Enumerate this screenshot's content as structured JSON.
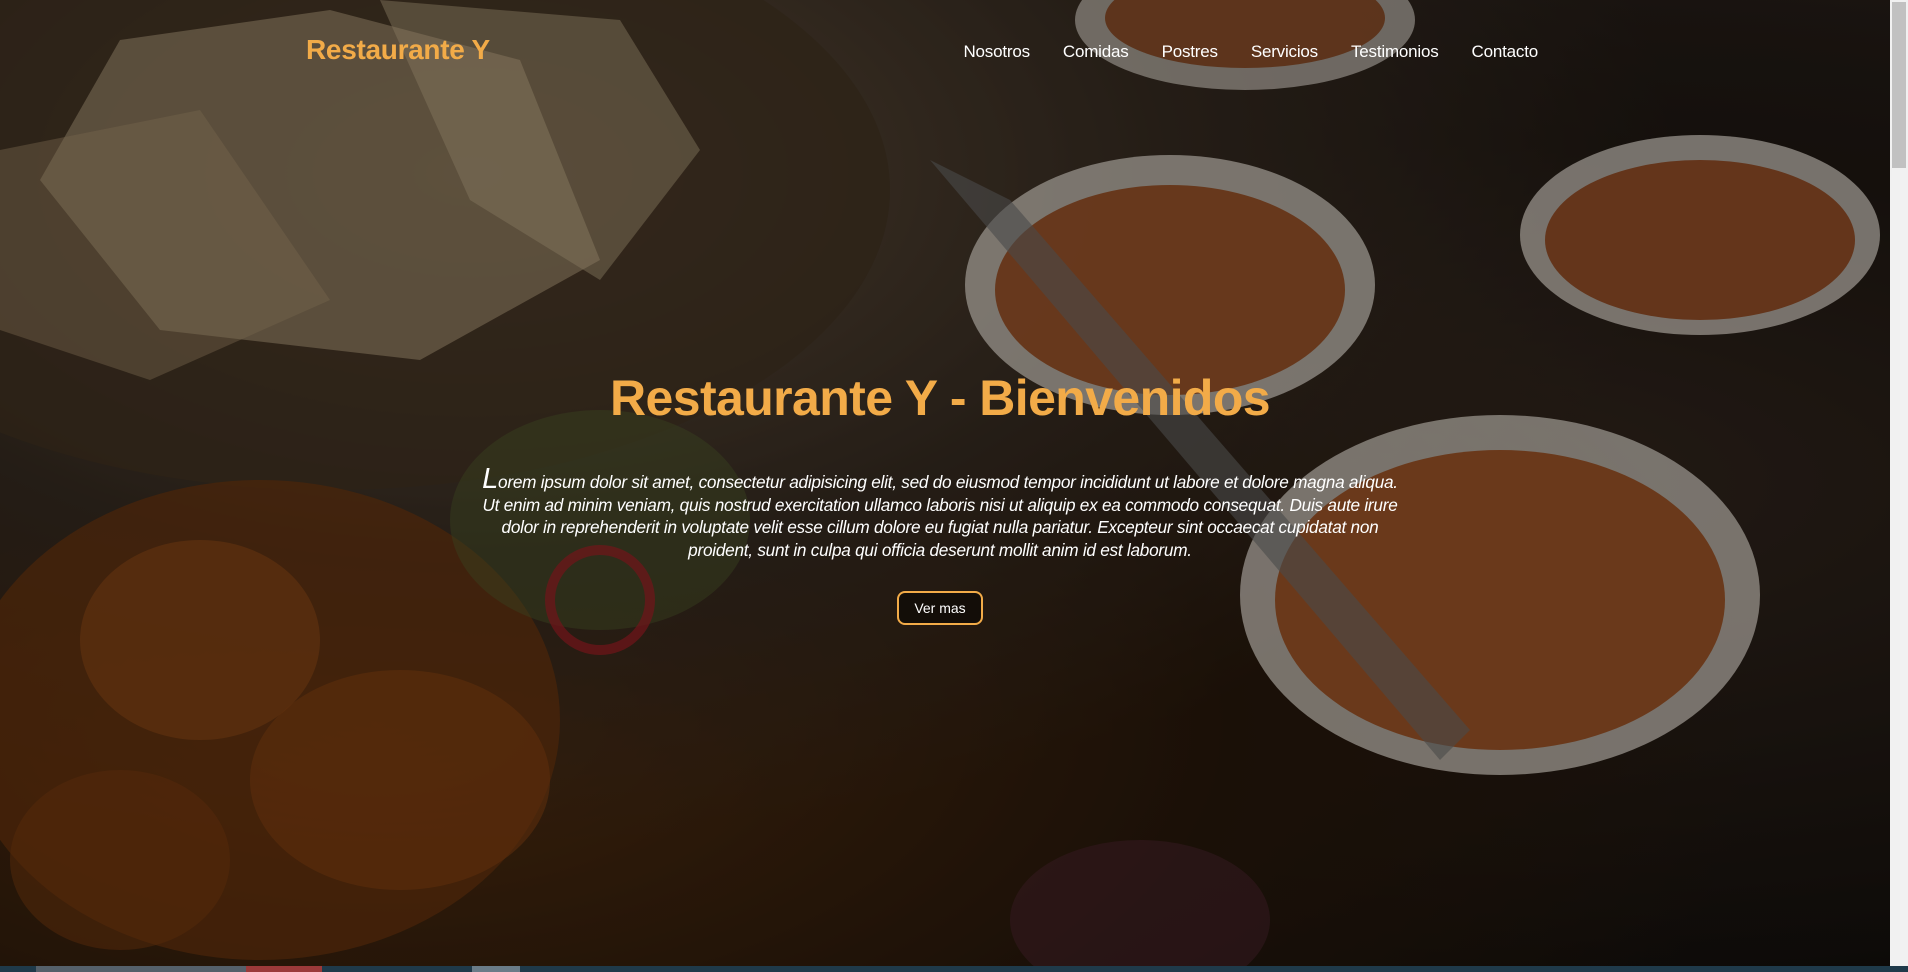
{
  "navbar": {
    "brand": "Restaurante Y",
    "links": [
      "Nosotros",
      "Comidas",
      "Postres",
      "Servicios",
      "Testimonios",
      "Contacto"
    ]
  },
  "hero": {
    "title": "Restaurante Y - Bienvenidos",
    "text_dropcap": "L",
    "text_body": "orem ipsum dolor sit amet, consectetur adipisicing elit, sed do eiusmod tempor incididunt ut labore et dolore magna aliqua. Ut enim ad minim veniam, quis nostrud exercitation ullamco laboris nisi ut aliquip ex ea commodo consequat. Duis aute irure dolor in reprehenderit in voluptate velit esse cillum dolore eu fugiat nulla pariatur. Excepteur sint occaecat cupidatat non proident, sunt in culpa qui officia deserunt mollit anim id est laborum.",
    "button_label": "Ver mas"
  },
  "colors": {
    "accent": "#f2ab48",
    "text": "#ffffff"
  }
}
